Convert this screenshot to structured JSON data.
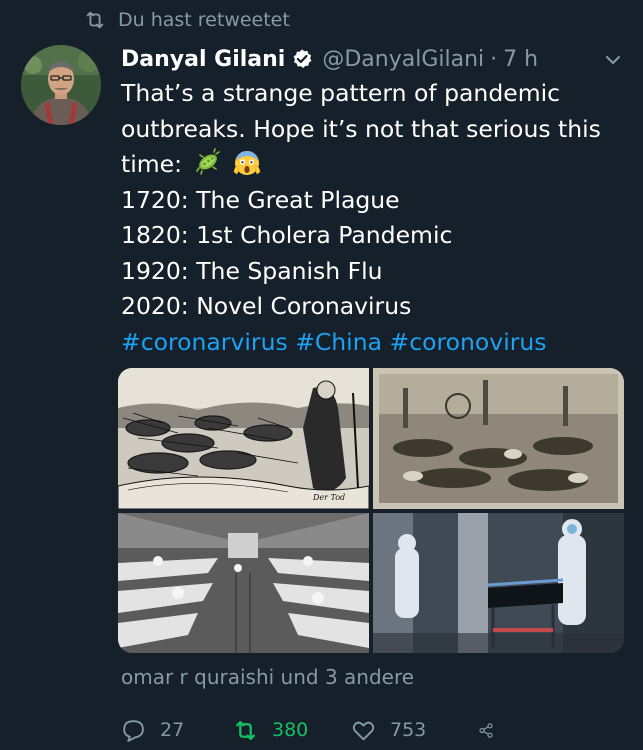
{
  "retweet_context": {
    "icon": "retweet-icon",
    "label": "Du hast retweetet"
  },
  "tweet": {
    "author": {
      "display_name": "Danyal Gilani",
      "verified": true,
      "handle": "@DanyalGilani",
      "separator": "·",
      "time": "7 h"
    },
    "text": {
      "intro_line1": "That’s a strange pattern of pandemic",
      "intro_line2": "outbreaks. Hope it’s not that serious this",
      "intro_line3": "time:",
      "emojis": [
        "microbe-emoji",
        "face-screaming-in-fear-emoji"
      ],
      "list": [
        "1720: The Great Plague",
        "1820: 1st Cholera Pandemic",
        "1920: The Spanish Flu",
        "2020: Novel Coronavirus"
      ],
      "hashtags": [
        "#coronarvirus",
        "#China",
        "#coronovirus"
      ]
    },
    "media": [
      {
        "name": "plague-engraving-image",
        "caption": "Der Tod"
      },
      {
        "name": "cholera-sketch-image"
      },
      {
        "name": "spanish-flu-ward-photo"
      },
      {
        "name": "coronavirus-hazmat-photo"
      }
    ],
    "liked_by": "omar r quraishi und 3 andere",
    "actions": {
      "replies": "27",
      "retweets": "380",
      "likes": "753"
    }
  },
  "colors": {
    "background": "#15202b",
    "text": "#ffffff",
    "muted": "#8899a6",
    "link": "#1da1f2",
    "retweet_active": "#17bf63"
  }
}
